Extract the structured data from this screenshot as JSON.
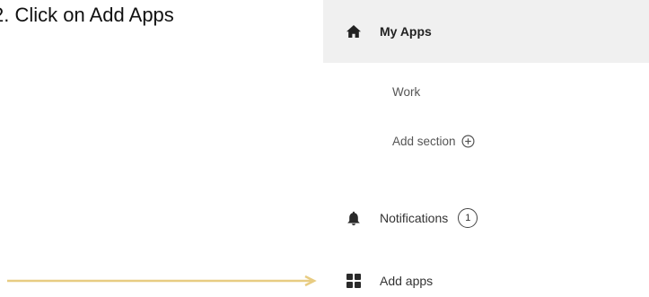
{
  "instruction": {
    "text": "2. Click on Add Apps"
  },
  "sidebar": {
    "my_apps": {
      "label": "My Apps",
      "icon": "home-icon"
    },
    "work": {
      "label": "Work"
    },
    "add_section": {
      "label": "Add section",
      "icon": "plus-circle-icon"
    },
    "notifications": {
      "label": "Notifications",
      "icon": "bell-icon",
      "count": "1"
    },
    "add_apps": {
      "label": "Add apps",
      "icon": "apps-grid-icon"
    }
  },
  "colors": {
    "arrow": "#e8cc82",
    "selected_background": "#f0f0f0",
    "icon": "#2a2a2a"
  }
}
